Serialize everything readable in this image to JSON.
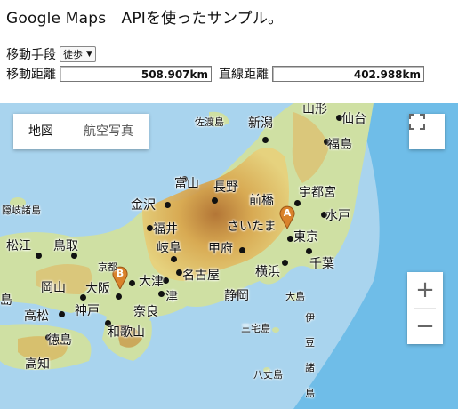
{
  "header": {
    "title": "Google Maps　APIを使ったサンプル。"
  },
  "form": {
    "travel_mode_label": "移動手段",
    "travel_mode_value": "徒歩",
    "travel_distance_label": "移動距離",
    "travel_distance_value": "508.907km",
    "straight_distance_label": "直線距離",
    "straight_distance_value": "402.988km"
  },
  "map": {
    "type_buttons": {
      "map": "地図",
      "satellite": "航空写真"
    },
    "zoom_in": "+",
    "zoom_out": "−",
    "markers": {
      "a": "A",
      "b": "B"
    },
    "labels": {
      "yamagata": "山形",
      "sendai": "仙台",
      "sadogashima": "佐渡島",
      "niigata": "新潟",
      "fukushima": "福島",
      "toyama": "富山",
      "nagano": "長野",
      "utsunomiya": "宇都宮",
      "kanazawa": "金沢",
      "maebashi": "前橋",
      "saitama": "さいたま",
      "mito": "水戸",
      "okishoto": "隠岐諸島",
      "fukui": "福井",
      "matsue": "松江",
      "tottori": "鳥取",
      "gifu": "岐阜",
      "kofu": "甲府",
      "tokyo": "東京",
      "yokohama": "横浜",
      "chiba": "千葉",
      "kyoto": "京都",
      "nagoya": "名古屋",
      "okayama": "岡山",
      "osaka": "大阪",
      "otsu": "大津",
      "shizuoka": "静岡",
      "oshima": "大島",
      "tsu": "津",
      "shima_left": "島",
      "takamatsu": "高松",
      "kobe": "神戸",
      "nara": "奈良",
      "izu1": "伊",
      "izu2": "豆",
      "tokushima": "徳島",
      "wakayama": "和歌山",
      "miyakejima": "三宅島",
      "shoto1": "諸",
      "kochi": "高知",
      "hachijojima": "八丈島",
      "shoto2": "島"
    }
  }
}
